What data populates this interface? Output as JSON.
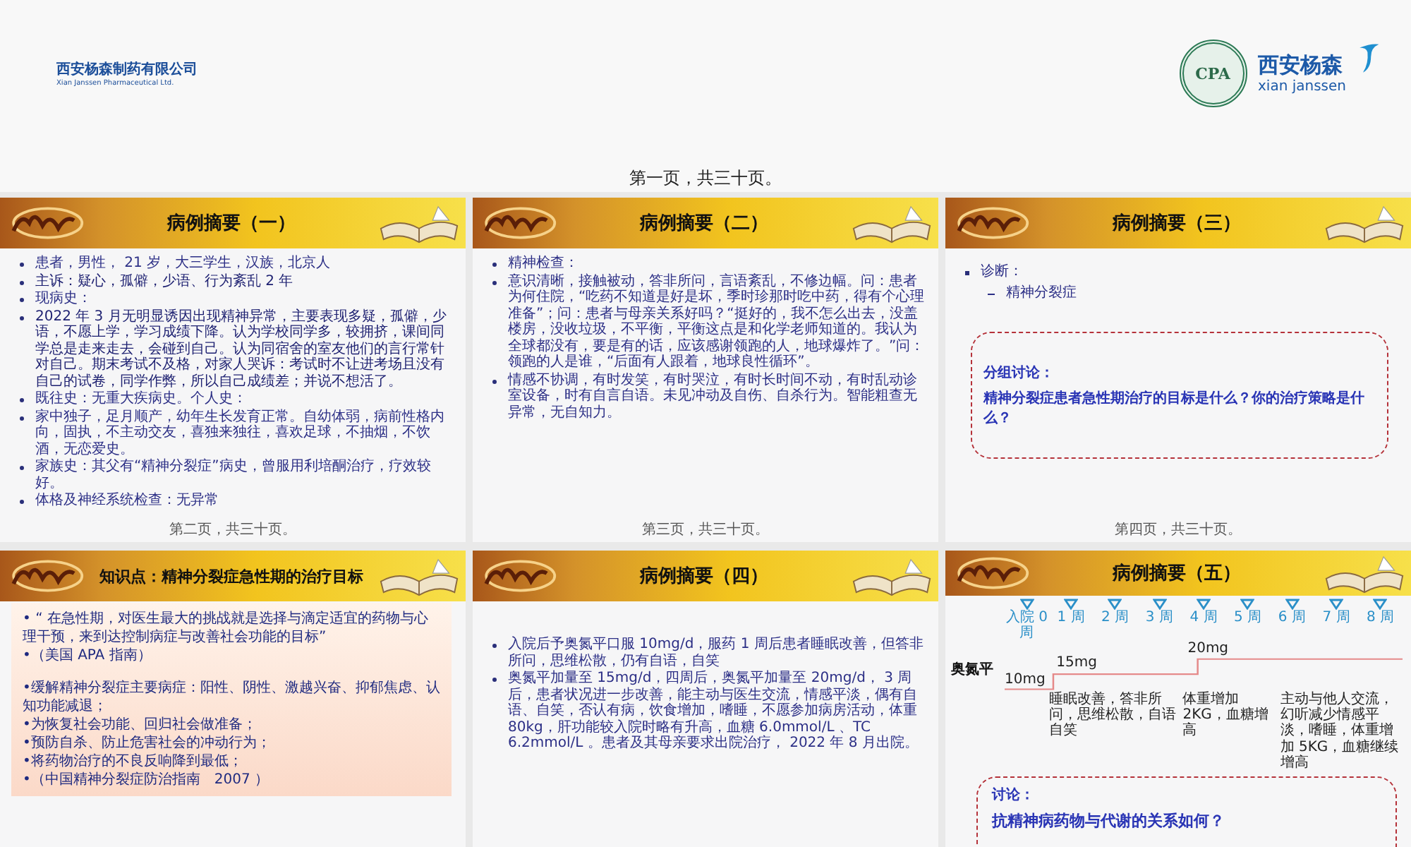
{
  "cover": {
    "company_name_cn": "西安杨森制药有限公司",
    "company_name_en": "Xian Janssen Pharmaceutical Ltd.",
    "emblem_label": "CPA",
    "brand_cn": "西安杨森",
    "brand_en": "xian janssen",
    "page_caption": "第一页，共三十页。"
  },
  "slides": [
    {
      "kind": "bullets",
      "title": "病例摘要（一）",
      "items": [
        {
          "text": "患者，男性， 21 岁，大三学生，汉族，北京人",
          "large": false
        },
        {
          "text": "主诉：疑心，孤僻，少语、行为紊乱 2 年",
          "large": true
        },
        {
          "text": "现病史：",
          "large": false
        },
        {
          "text": "2022 年 3 月无明显诱因出现精神异常，主要表现多疑，孤僻，少语，不愿上学，学习成绩下降。认为学校同学多，较拥挤，课间同学总是走来走去，会碰到自己。认为同宿舍的室友他们的言行常针对自己。期末考试不及格，对家人哭诉：考试时不让进考场且没有自己的试卷，同学作弊，所以自己成绩差；并说不想活了。",
          "large": true
        },
        {
          "text": "既往史：无重大疾病史。个人史：",
          "large": false
        },
        {
          "text": "家中独子，足月顺产，幼年生长发育正常。自幼体弱，病前性格内向，固执，不主动交友，喜独来独往，喜欢足球，不抽烟，不饮酒，无恋爱史。",
          "large": false
        },
        {
          "text": "家族史：其父有“精神分裂症”病史，曾服用利培酮治疗，疗效较好。",
          "large": false
        },
        {
          "text": "体格及神经系统检查：无异常",
          "large": false
        }
      ],
      "footer": "第二页，共三十页。"
    },
    {
      "kind": "bullets",
      "title": "病例摘要（二）",
      "items": [
        {
          "text": "精神检查：",
          "large": false
        },
        {
          "text": "意识清晰，接触被动，答非所问，言语紊乱，不修边幅。问：患者为何住院，“吃药不知道是好是坏，季时珍那时吃中药，得有个心理准备”；问：患者与母亲关系好吗？“挺好的，我不怎么出去，没盖楼房，没收垃圾，不平衡，平衡这点是和化学老师知道的。我认为全球都没有，要是有的话，应该感谢领跑的人，地球爆炸了。”问：领跑的人是谁，“后面有人跟着，地球良性循环”。",
          "large": false
        },
        {
          "text": "情感不协调，有时发笑，有时哭泣，有时长时间不动，有时乱动诊室设备，时有自言自语。未见冲动及自伤、自杀行为。智能粗查无异常，无自知力。",
          "large": false
        }
      ],
      "footer": "第三页，共三十页。"
    },
    {
      "kind": "diagnosis",
      "title": "病例摘要（三）",
      "heading": "诊断：",
      "sub_items": [
        "精神分裂症"
      ],
      "discussion": {
        "label": "分组讨论：",
        "question": "精神分裂症患者急性期治疗的目标是什么？你的治疗策略是什么？"
      },
      "footer": "第四页，共三十页。"
    },
    {
      "kind": "knowledge",
      "title": "知识点：精神分裂症急性期的治疗目标",
      "groups": [
        [
          "• “ 在急性期，对医生最大的挑战就是选择与滴定适宜的药物与心理干预，来到达控制病症与改善社会功能的目标”",
          "•（美国 APA 指南）"
        ],
        [
          "•缓解精神分裂症主要病症：阳性、阴性、激越兴奋、抑郁焦虑、认知功能减退；",
          "•为恢复社会功能、回归社会做准备；",
          "•预防自杀、防止危害社会的冲动行为；",
          "•将药物治疗的不良反响降到最低；",
          "•（中国精神分裂症防治指南　2007 ）"
        ]
      ]
    },
    {
      "kind": "bullets",
      "title": "病例摘要（四）",
      "items": [
        {
          "text": "入院后予奥氮平口服 10mg/d，服药 1 周后患者睡眠改善，但答非所问，思维松散，仍有自语，自笑",
          "large": false
        },
        {
          "text": "奥氮平加量至 15mg/d，四周后，奥氮平加量至 20mg/d， 3 周后，患者状况进一步改善，能主动与医生交流，情感平淡，偶有自语、自笑，否认有病，饮食增加，嗜睡，不愿参加病房活动，体重 80kg，肝功能较入院时略有升高，血糖 6.0mmol/L 、TC 6.2mmol/L 。患者及其母亲要求出院治疗， 2022 年 8 月出院。",
          "large": false
        }
      ]
    },
    {
      "kind": "timeline",
      "title": "病例摘要（五）",
      "weeks": [
        "入院 0 周",
        "1 周",
        "2 周",
        "3 周",
        "4 周",
        "5 周",
        "6 周",
        "7 周",
        "8 周"
      ],
      "drug": "奥氮平",
      "doses": [
        "10mg",
        "15mg",
        "20mg"
      ],
      "notes": [
        "睡眠改善，答非所问，思维松散，自语自笑",
        "体重增加 2KG，血糖增高",
        "主动与他人交流，幻听减少情感平淡，嗜睡，体重增加 5KG，血糖继续增高"
      ],
      "discussion": {
        "label": "讨论：",
        "question": "抗精神病药物与代谢的关系如何？"
      }
    }
  ]
}
